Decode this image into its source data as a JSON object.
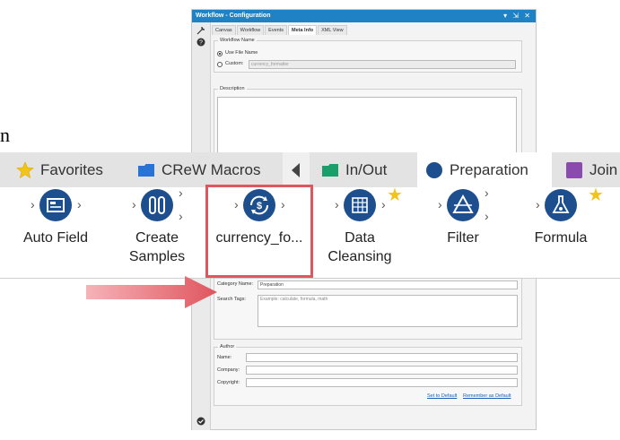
{
  "page_fragment": "n",
  "window": {
    "title": "Workflow - Configuration",
    "controls": "▾ ⇲ ✕",
    "tabs": [
      {
        "label": "Canvas"
      },
      {
        "label": "Workflow"
      },
      {
        "label": "Events"
      },
      {
        "label": "Meta Info"
      },
      {
        "label": "XML View"
      }
    ],
    "workflow_name": {
      "group_title": "Workflow Name",
      "use_file_name": "Use File Name",
      "custom_label": "Custom:",
      "custom_value": "currency_formatter"
    },
    "description_title": "Description",
    "category_name_label": "Category Name:",
    "category_name_value": "Preparation",
    "search_tags_label": "Search Tags:",
    "search_tags_placeholder": "Example: calculate, formula, math",
    "author": {
      "group_title": "Author",
      "name_label": "Name:",
      "company_label": "Company:",
      "copyright_label": "Copyright:"
    },
    "set_default": "Set to Default",
    "remember_default": "Remember as Default"
  },
  "palette": {
    "tabs": [
      {
        "label": "Favorites",
        "icon": "star-icon",
        "color": "#f2c418"
      },
      {
        "label": "CReW Macros",
        "icon": "folder-icon",
        "color": "#2a73d6"
      },
      {
        "label": "In/Out",
        "icon": "folder-icon",
        "color": "#1a9e6a"
      },
      {
        "label": "Preparation",
        "icon": "circle-icon",
        "color": "#1d4f8f"
      },
      {
        "label": "Join",
        "icon": "square-icon",
        "color": "#8a4bb0"
      }
    ],
    "tools": [
      {
        "label": "Auto Field"
      },
      {
        "label": "Create\nSamples"
      },
      {
        "label": "currency_fo..."
      },
      {
        "label": "Data\nCleansing"
      },
      {
        "label": "Filter"
      },
      {
        "label": "Formula"
      }
    ]
  },
  "colors": {
    "accent": "#1f82c4",
    "highlight": "#e0555e",
    "tool_icon": "#1d4f8f"
  }
}
